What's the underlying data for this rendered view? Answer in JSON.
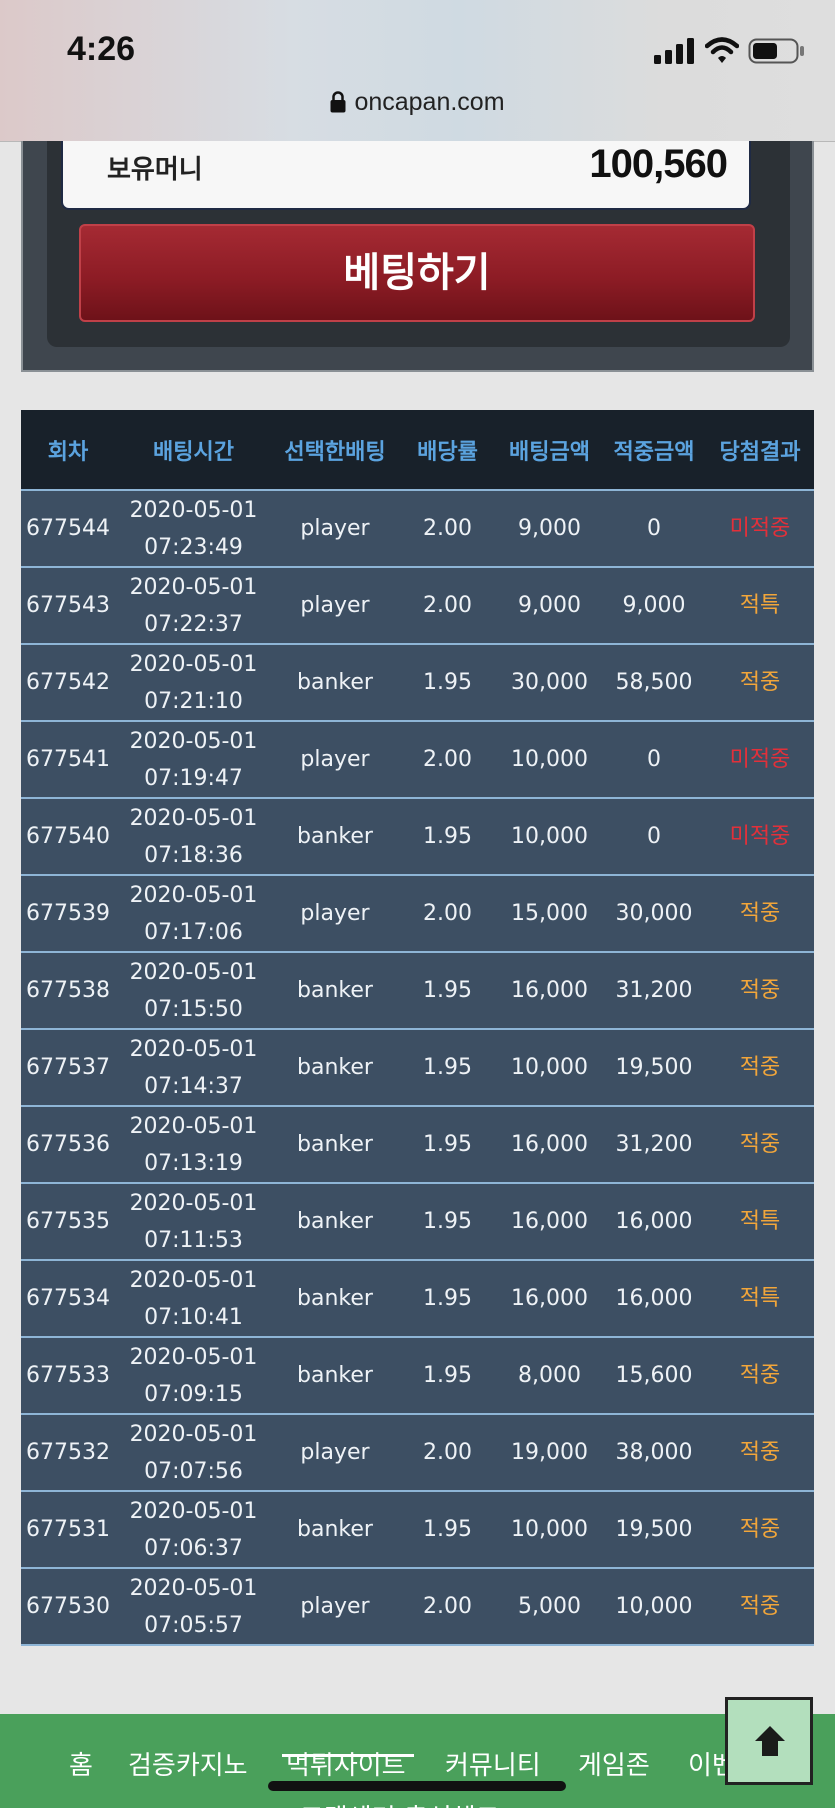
{
  "status_bar": {
    "time": "4:26",
    "url": "oncapan.com"
  },
  "wallet": {
    "label": "보유머니",
    "value": "100,560"
  },
  "bet_button_label": "베팅하기",
  "table": {
    "headers": [
      "회차",
      "배팅시간",
      "선택한배팅",
      "배당률",
      "배팅금액",
      "적중금액",
      "당첨결과"
    ],
    "rows": [
      {
        "round": "677544",
        "date": "2020-05-01",
        "time": "07:23:49",
        "choice": "player",
        "odds": "2.00",
        "bet": "9,000",
        "payout": "0",
        "result": "미적중",
        "result_type": "lose"
      },
      {
        "round": "677543",
        "date": "2020-05-01",
        "time": "07:22:37",
        "choice": "player",
        "odds": "2.00",
        "bet": "9,000",
        "payout": "9,000",
        "result": "적특",
        "result_type": "special"
      },
      {
        "round": "677542",
        "date": "2020-05-01",
        "time": "07:21:10",
        "choice": "banker",
        "odds": "1.95",
        "bet": "30,000",
        "payout": "58,500",
        "result": "적중",
        "result_type": "win"
      },
      {
        "round": "677541",
        "date": "2020-05-01",
        "time": "07:19:47",
        "choice": "player",
        "odds": "2.00",
        "bet": "10,000",
        "payout": "0",
        "result": "미적중",
        "result_type": "lose"
      },
      {
        "round": "677540",
        "date": "2020-05-01",
        "time": "07:18:36",
        "choice": "banker",
        "odds": "1.95",
        "bet": "10,000",
        "payout": "0",
        "result": "미적중",
        "result_type": "lose"
      },
      {
        "round": "677539",
        "date": "2020-05-01",
        "time": "07:17:06",
        "choice": "player",
        "odds": "2.00",
        "bet": "15,000",
        "payout": "30,000",
        "result": "적중",
        "result_type": "win"
      },
      {
        "round": "677538",
        "date": "2020-05-01",
        "time": "07:15:50",
        "choice": "banker",
        "odds": "1.95",
        "bet": "16,000",
        "payout": "31,200",
        "result": "적중",
        "result_type": "win"
      },
      {
        "round": "677537",
        "date": "2020-05-01",
        "time": "07:14:37",
        "choice": "banker",
        "odds": "1.95",
        "bet": "10,000",
        "payout": "19,500",
        "result": "적중",
        "result_type": "win"
      },
      {
        "round": "677536",
        "date": "2020-05-01",
        "time": "07:13:19",
        "choice": "banker",
        "odds": "1.95",
        "bet": "16,000",
        "payout": "31,200",
        "result": "적중",
        "result_type": "win"
      },
      {
        "round": "677535",
        "date": "2020-05-01",
        "time": "07:11:53",
        "choice": "banker",
        "odds": "1.95",
        "bet": "16,000",
        "payout": "16,000",
        "result": "적특",
        "result_type": "special"
      },
      {
        "round": "677534",
        "date": "2020-05-01",
        "time": "07:10:41",
        "choice": "banker",
        "odds": "1.95",
        "bet": "16,000",
        "payout": "16,000",
        "result": "적특",
        "result_type": "special"
      },
      {
        "round": "677533",
        "date": "2020-05-01",
        "time": "07:09:15",
        "choice": "banker",
        "odds": "1.95",
        "bet": "8,000",
        "payout": "15,600",
        "result": "적중",
        "result_type": "win"
      },
      {
        "round": "677532",
        "date": "2020-05-01",
        "time": "07:07:56",
        "choice": "player",
        "odds": "2.00",
        "bet": "19,000",
        "payout": "38,000",
        "result": "적중",
        "result_type": "win"
      },
      {
        "round": "677531",
        "date": "2020-05-01",
        "time": "07:06:37",
        "choice": "banker",
        "odds": "1.95",
        "bet": "10,000",
        "payout": "19,500",
        "result": "적중",
        "result_type": "win"
      },
      {
        "round": "677530",
        "date": "2020-05-01",
        "time": "07:05:57",
        "choice": "player",
        "odds": "2.00",
        "bet": "5,000",
        "payout": "10,000",
        "result": "적중",
        "result_type": "win"
      }
    ]
  },
  "bottom_nav": {
    "items": [
      "홈",
      "검증카지노",
      "먹튀사이트",
      "커뮤니티",
      "게임존",
      "이벤트"
    ],
    "active": "먹튀사이트",
    "second_row_partial": "고객센터  출석체크"
  },
  "colors": {
    "header_bg": "#18212a",
    "header_text": "#5ba3df",
    "row_bg": "#3d4f63",
    "lose": "#e2303a",
    "win": "#f2a63a",
    "nav_bg": "#4aa05b",
    "bet_button": "#8d1c25"
  },
  "icons": [
    "lock-icon",
    "signal-icon",
    "wifi-icon",
    "battery-icon",
    "arrow-up-icon"
  ]
}
